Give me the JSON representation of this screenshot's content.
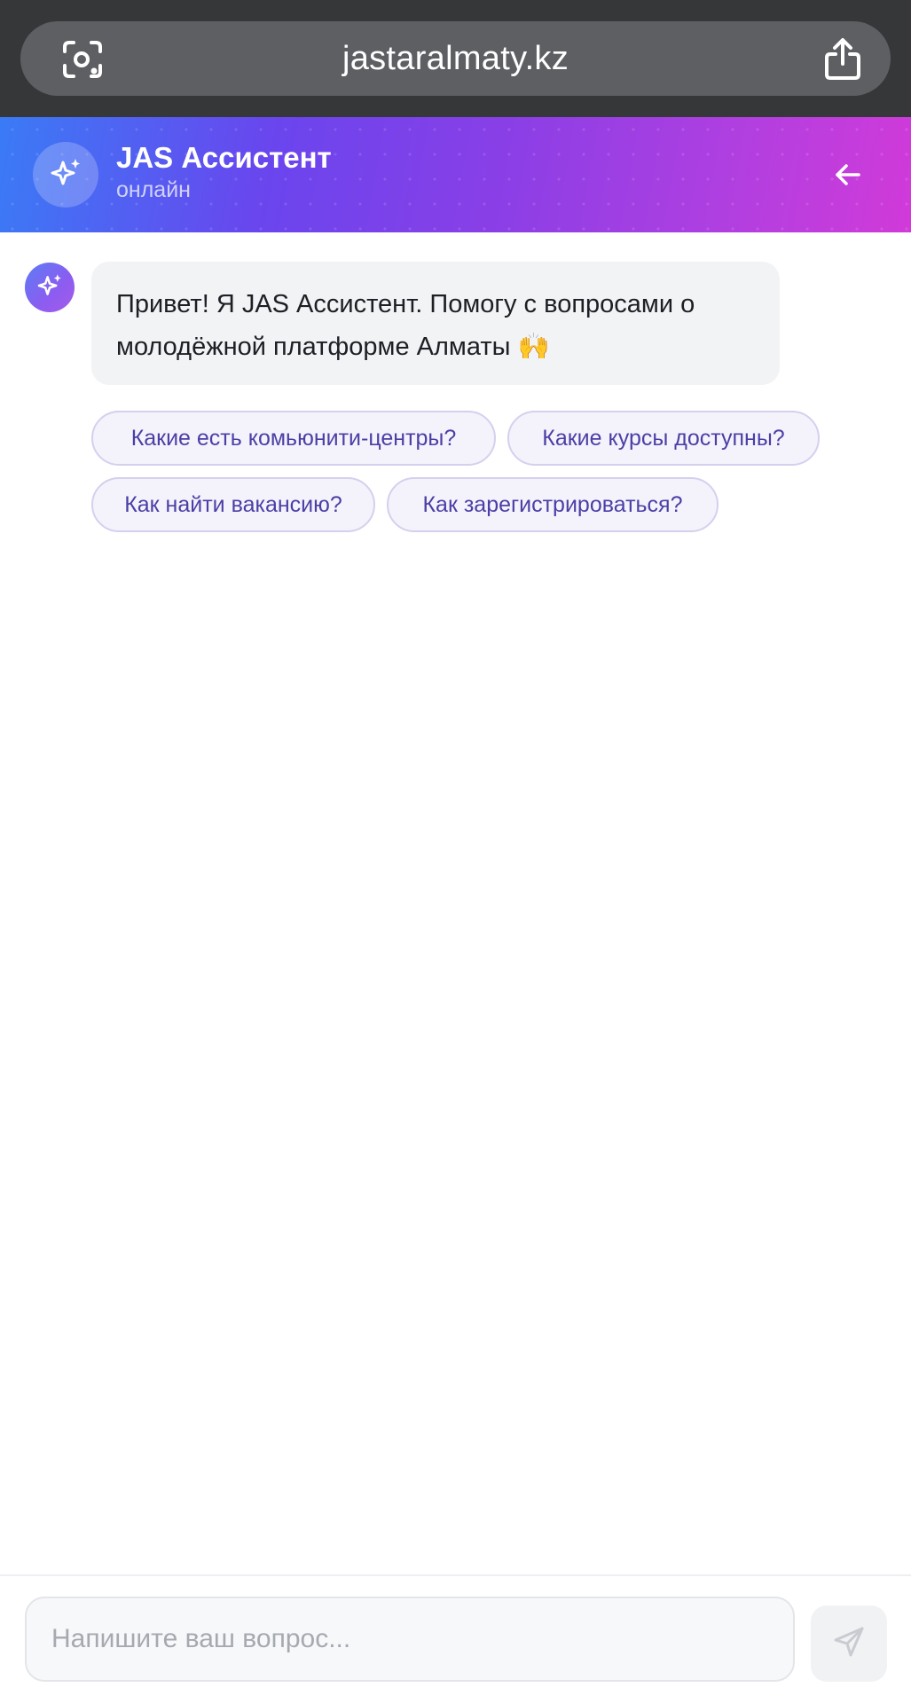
{
  "browser": {
    "url": "jastaralmaty.kz",
    "lens_icon": "camera-lens-icon",
    "share_icon": "share-icon"
  },
  "header": {
    "title": "JAS Ассистент",
    "status": "онлайн",
    "avatar_icon": "sparkle-icon",
    "back_icon": "arrow-left-icon",
    "gradient_colors": [
      "#3a7bf6",
      "#8a3fe6",
      "#d13ad9"
    ]
  },
  "messages": [
    {
      "sender": "bot",
      "text": "Привет! Я JAS Ассистент. Помогу с вопросами о молодёжной платформе Алматы 🙌"
    }
  ],
  "suggestions": [
    "Какие есть комьюнити-центры?",
    "Какие курсы доступны?",
    "Как найти вакансию?",
    "Как зарегистрироваться?"
  ],
  "composer": {
    "placeholder": "Напишите ваш вопрос...",
    "value": "",
    "send_icon": "send-icon"
  },
  "colors": {
    "chip_text": "#4b3fa6",
    "chip_border": "#d4d0ee",
    "bubble_bg": "#f2f3f5"
  }
}
